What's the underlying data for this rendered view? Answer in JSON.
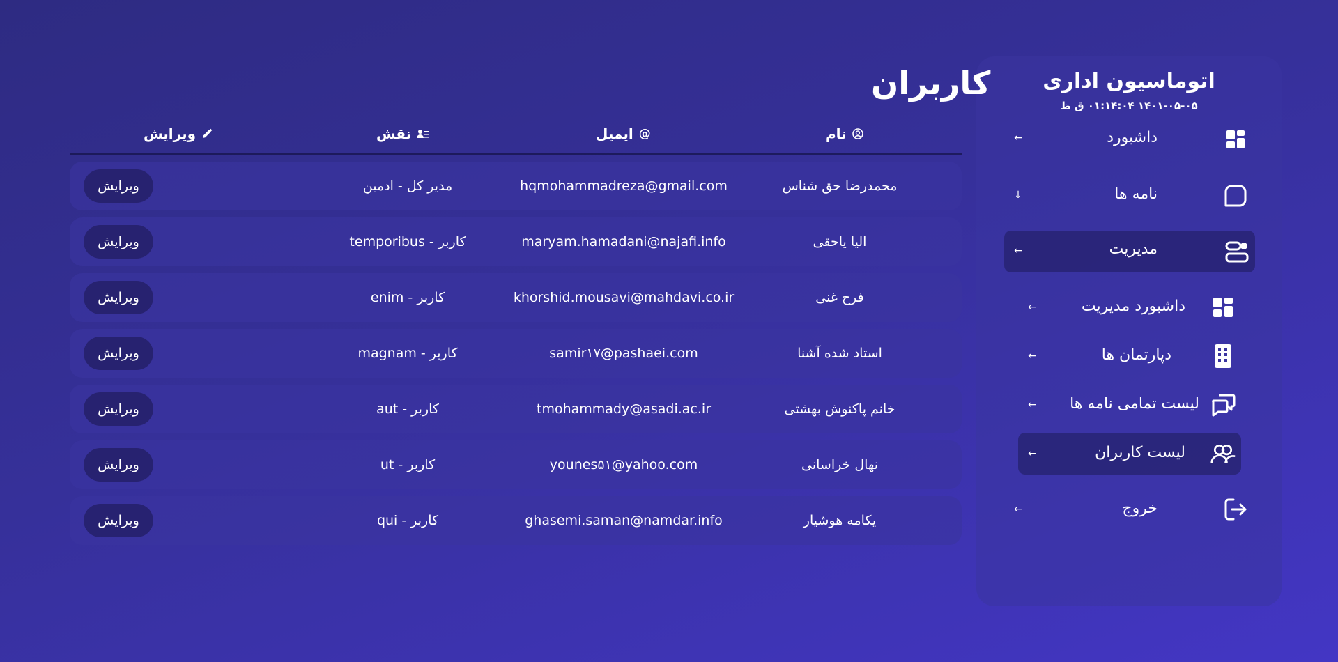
{
  "sidebar": {
    "app_title": "اتوماسیون اداری",
    "datetime": "۱۴۰۱-۰۵-۰۵ ۰۱:۱۴:۰۴ ق ظ",
    "items": [
      {
        "label": "داشبورد",
        "icon": "dashboard-icon",
        "arrow": "←"
      },
      {
        "label": "نامه ها",
        "icon": "message-square-icon",
        "arrow": "↓"
      },
      {
        "label": "مدیریت",
        "icon": "admin-icon",
        "arrow": "←"
      },
      {
        "label": "داشبورد مدیریت",
        "icon": "dashboard-icon",
        "arrow": "←"
      },
      {
        "label": "دپارتمان ها",
        "icon": "building-icon",
        "arrow": "←"
      },
      {
        "label": "لیست تمامی نامه ها",
        "icon": "chat-bubbles-icon",
        "arrow": "←"
      },
      {
        "label": "لیست کاربران",
        "icon": "users-icon",
        "arrow": "←"
      },
      {
        "label": "خروج",
        "icon": "logout-icon",
        "arrow": "←"
      }
    ]
  },
  "main": {
    "title": "کاربران",
    "columns": {
      "name": "نام",
      "email": "ایمیل",
      "role": "نقش",
      "edit": "ویرایش"
    },
    "edit_button_label": "ویرایش",
    "rows": [
      {
        "name": "محمدرضا حق شناس",
        "email": "hqmohammadreza@gmail.com",
        "role": "مدیر کل - ادمین"
      },
      {
        "name": "الیا یاحقی",
        "email": "maryam.hamadani@najafi.info",
        "role": "temporibus - کاربر"
      },
      {
        "name": "فرح غنی",
        "email": "khorshid.mousavi@mahdavi.co.ir",
        "role": "enim - کاربر"
      },
      {
        "name": "استاد شده آشنا",
        "email": "samir۱۷@pashaei.com",
        "role": "magnam - کاربر"
      },
      {
        "name": "خانم پاکنوش بهشتی",
        "email": "tmohammady@asadi.ac.ir",
        "role": "aut - کاربر"
      },
      {
        "name": "نهال خراسانی",
        "email": "younes۵۱@yahoo.com",
        "role": "ut - کاربر"
      },
      {
        "name": "یکامه هوشیار",
        "email": "ghasemi.saman@namdar.info",
        "role": "qui - کاربر"
      }
    ]
  },
  "colors": {
    "bg_start": "#2e2b82",
    "bg_end": "#4336c4",
    "card": "#3a34a0",
    "active": "#26216e"
  }
}
